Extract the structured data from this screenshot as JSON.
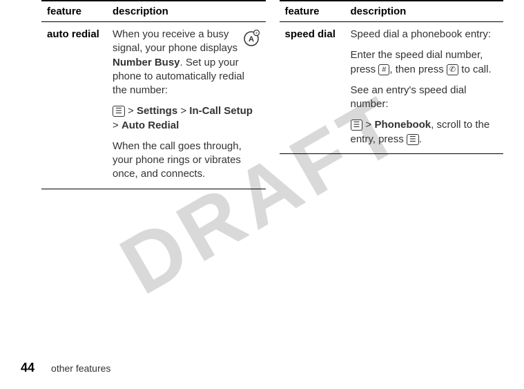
{
  "watermark": "DRAFT",
  "left_table": {
    "header_feature": "feature",
    "header_description": "description",
    "row": {
      "feature": "auto redial",
      "p1_a": "When you receive a busy signal, your phone displays ",
      "p1_bold": "Number Busy",
      "p1_b": ". Set up your phone to automatically redial the number:",
      "nav_sep1": " > ",
      "nav_settings": "Settings",
      "nav_sep2": " > ",
      "nav_incall": "In-Call Setup",
      "nav_sep3": " > ",
      "nav_autoredial": "Auto Redial",
      "p3": "When the call goes through, your phone rings or vibrates once, and connects."
    }
  },
  "right_table": {
    "header_feature": "feature",
    "header_description": "description",
    "row": {
      "feature": "speed dial",
      "p1": "Speed dial a phonebook entry:",
      "p2_a": "Enter the speed dial number, press ",
      "p2_hash": "#",
      "p2_b": ", then press ",
      "p2_send": "✆",
      "p2_c": " to call.",
      "p3": "See an entry's speed dial number:",
      "p4_sep1": " > ",
      "p4_pb": "Phonebook",
      "p4_b": ", scroll to the entry, press ",
      "p4_c": "."
    }
  },
  "footer": {
    "page": "44",
    "section": "other features"
  }
}
